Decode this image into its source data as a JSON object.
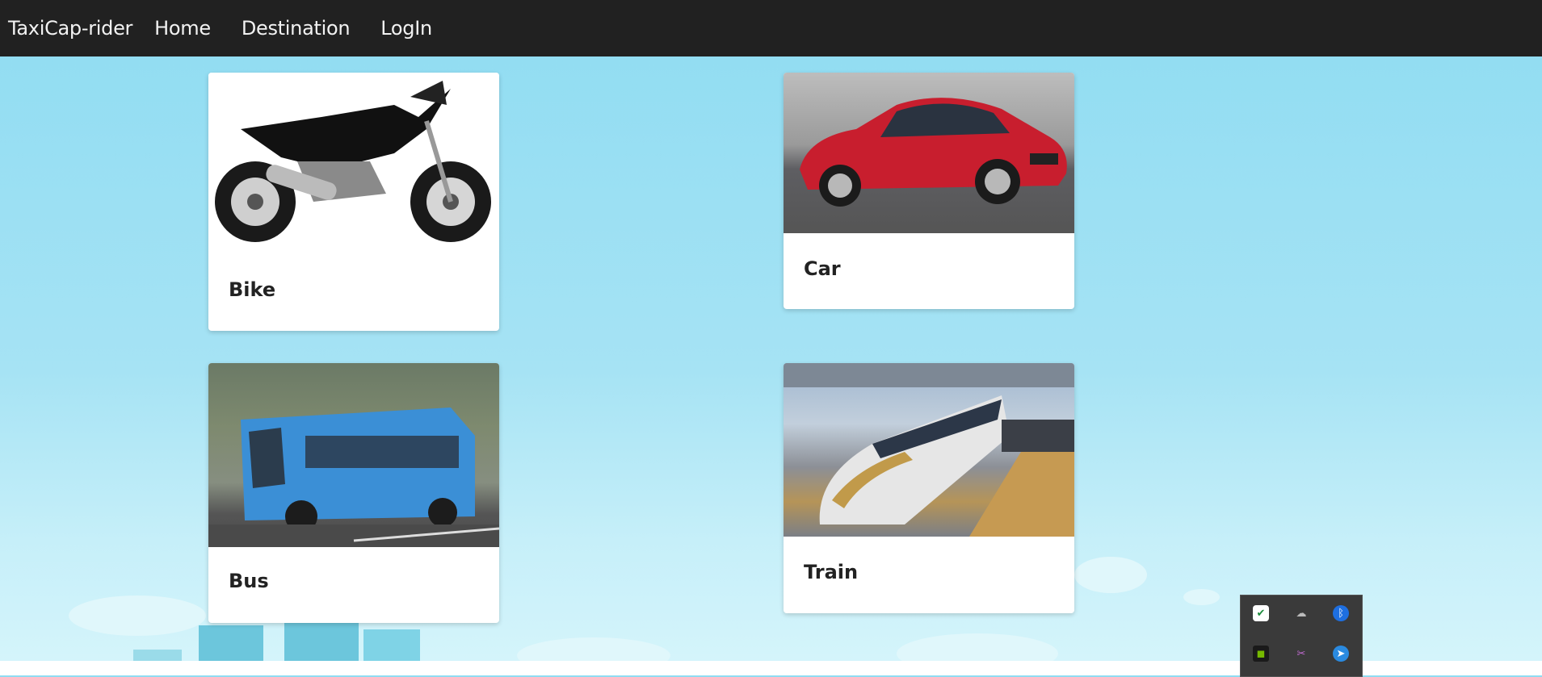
{
  "nav": {
    "brand": "TaxiCap-rider",
    "links": [
      "Home",
      "Destination",
      "LogIn"
    ]
  },
  "cards": [
    {
      "title": "Bike",
      "image": "motorcycle"
    },
    {
      "title": "Car",
      "image": "red-sedan"
    },
    {
      "title": "Bus",
      "image": "blue-bus"
    },
    {
      "title": "Train",
      "image": "bullet-train"
    }
  ],
  "tray": {
    "icons": [
      "shield-check-icon",
      "cloud-off-icon",
      "bluetooth-icon",
      "nvidia-icon",
      "onenote-clip-icon",
      "pointer-app-icon"
    ]
  },
  "colors": {
    "navbar": "#212121",
    "background": "#8fdcf2",
    "card": "#ffffff"
  }
}
